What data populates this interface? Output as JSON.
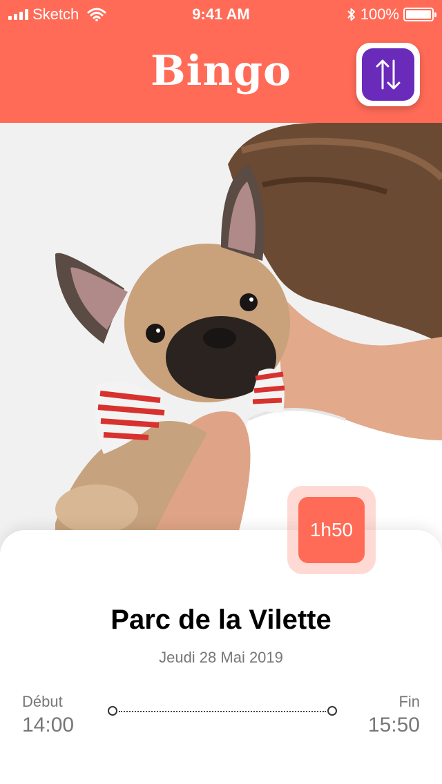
{
  "status_bar": {
    "carrier": "Sketch",
    "time": "9:41 AM",
    "battery": "100%"
  },
  "header": {
    "title": "Bingo",
    "swap_icon": "swap-vertical-arrows-icon",
    "accent_color": "#ff6b57",
    "button_color": "#6a2bbb"
  },
  "photo": {
    "subject": "child-holding-french-bulldog"
  },
  "event": {
    "duration": "1h50",
    "place": "Parc de la Vilette",
    "date": "Jeudi 28 Mai 2019",
    "start_label": "Début",
    "start_time": "14:00",
    "end_label": "Fin",
    "end_time": "15:50"
  }
}
